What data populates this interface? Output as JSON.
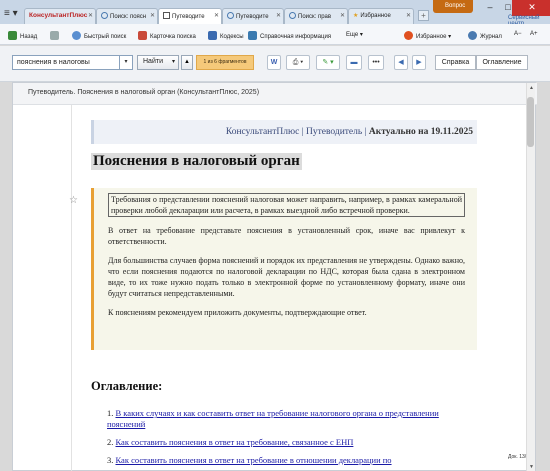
{
  "tabs": [
    {
      "label": "КонсультантПлюс",
      "active": false
    },
    {
      "label": "Поиск: поясн",
      "active": false
    },
    {
      "label": "Путеводите",
      "active": true
    },
    {
      "label": "Путеводите",
      "active": false
    },
    {
      "label": "Поиск: прав",
      "active": false
    },
    {
      "label": "Избранное",
      "active": false
    }
  ],
  "window": {
    "question_label": "Вопрос",
    "service_label": "Сервисный центр"
  },
  "toolbar": {
    "back": "Назад",
    "quick_search": "Быстрый поиск",
    "card_search": "Карточка поиска",
    "codes": "Кодексы",
    "reference": "Справочная информация",
    "more": "Еще",
    "favorites": "Избранное",
    "journal": "Журнал",
    "font_smaller": "A−",
    "font_larger": "A+"
  },
  "search": {
    "value": "пояснения в налоговы",
    "find_label": "Найти",
    "fragments": "1 из 6 фрагментов",
    "tab_reference": "Справка",
    "tab_contents": "Оглавление"
  },
  "doc": {
    "header": "Путеводитель. Пояснения в налоговый орган (КонсультантПлюс, 2025)",
    "brand": "КонсультантПлюс | Путеводитель | ",
    "actual": "Актуально на 19.11.2025",
    "title": "Пояснения в налоговый орган",
    "summary": [
      "Требования о представлении пояснений налоговая может направить, например, в рамках камеральной проверки любой декларации или расчета, в рамках выездной либо встречной проверки.",
      "В ответ на требование представьте пояснения в установленный срок, иначе вас привлекут к ответственности.",
      "Для большинства случаев форма пояснений и порядок их представления не утверждены. Однако важно, что если пояснения подаются по налоговой декларации по НДС, которая была сдана в электронном виде, то их тоже нужно подать только в электронной форме по установленному формату, иначе они будут считаться непредставленными.",
      "К пояснениям рекомендуем приложить документы, подтверждающие ответ."
    ],
    "toc_title": "Оглавление:",
    "toc": [
      {
        "num": "1.",
        "text": "В каких случаях и как составить ответ на требование налогового органа о представлении пояснений"
      },
      {
        "num": "2.",
        "text": "Как составить пояснения в ответ на требование, связанное с ЕНП"
      },
      {
        "num": "3.",
        "text": "Как составить пояснения в ответ на требование в отношении декларации по"
      }
    ]
  },
  "status": {
    "doc_label": "Док. 13/"
  }
}
